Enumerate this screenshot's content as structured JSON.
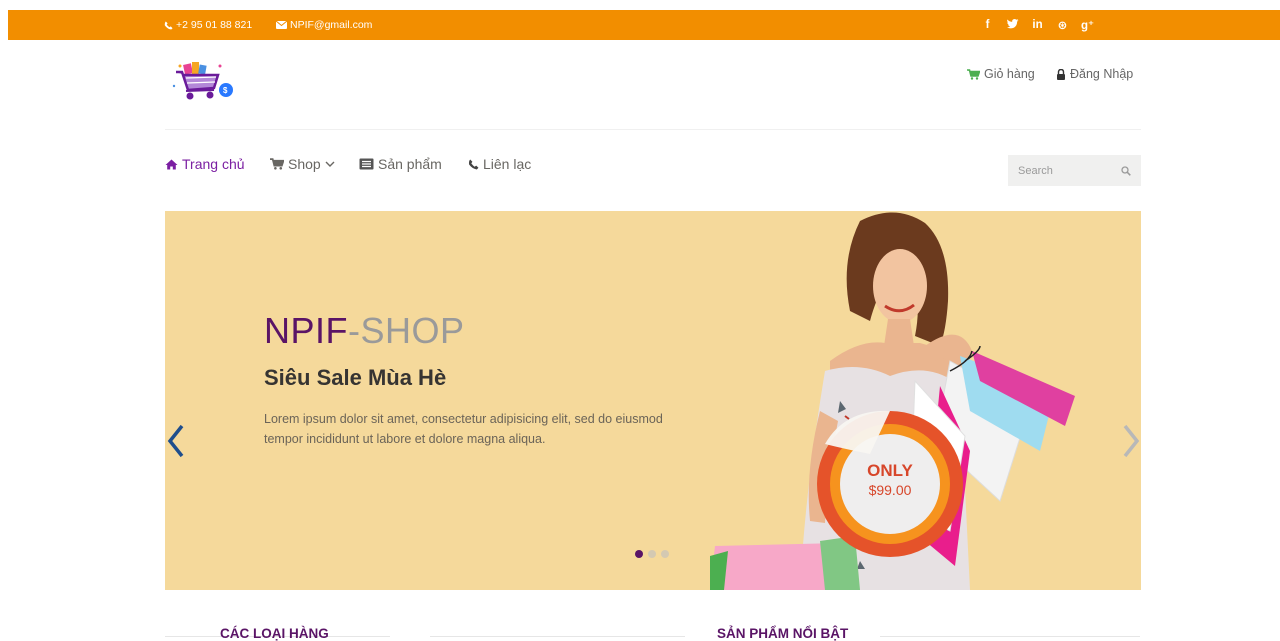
{
  "topbar": {
    "phone": "+2 95 01 88 821",
    "email": "NPIF@gmail.com",
    "socials": [
      {
        "icon": "facebook-icon",
        "label": "f"
      },
      {
        "icon": "twitter-icon",
        "label": "🐦"
      },
      {
        "icon": "linkedin-icon",
        "label": "in"
      },
      {
        "icon": "dribbble-icon",
        "label": "⊛"
      },
      {
        "icon": "google-plus-icon",
        "label": "g⁺"
      }
    ],
    "color": "#f28e00"
  },
  "header": {
    "cart_label": "Giỏ hàng",
    "login_label": "Đăng Nhập"
  },
  "nav": {
    "items": [
      {
        "label": "Trang chủ",
        "icon": "home-icon",
        "active": true
      },
      {
        "label": "Shop",
        "icon": "cart-icon",
        "dropdown": true
      },
      {
        "label": "Sản phẩm",
        "icon": "list-icon"
      },
      {
        "label": "Liên lạc",
        "icon": "phone-icon"
      }
    ],
    "search_placeholder": "Search",
    "active_color": "#7b1fa2"
  },
  "slider": {
    "brand_part1": "NPIF",
    "brand_part2": "-SHOP",
    "slogan": "Siêu Sale Mùa Hè",
    "description": "Lorem ipsum dolor sit amet, consectetur adipisicing elit, sed do eiusmod tempor incididunt ut labore et dolore magna aliqua.",
    "badge_only": "ONLY",
    "badge_price": "$99.00",
    "background": "#f5d99b",
    "slide_count": 3,
    "active_slide": 1
  },
  "sections": {
    "categories_title": "CÁC LOẠI HÀNG",
    "featured_title": "SẢN PHẨM NỔI BẬT"
  }
}
